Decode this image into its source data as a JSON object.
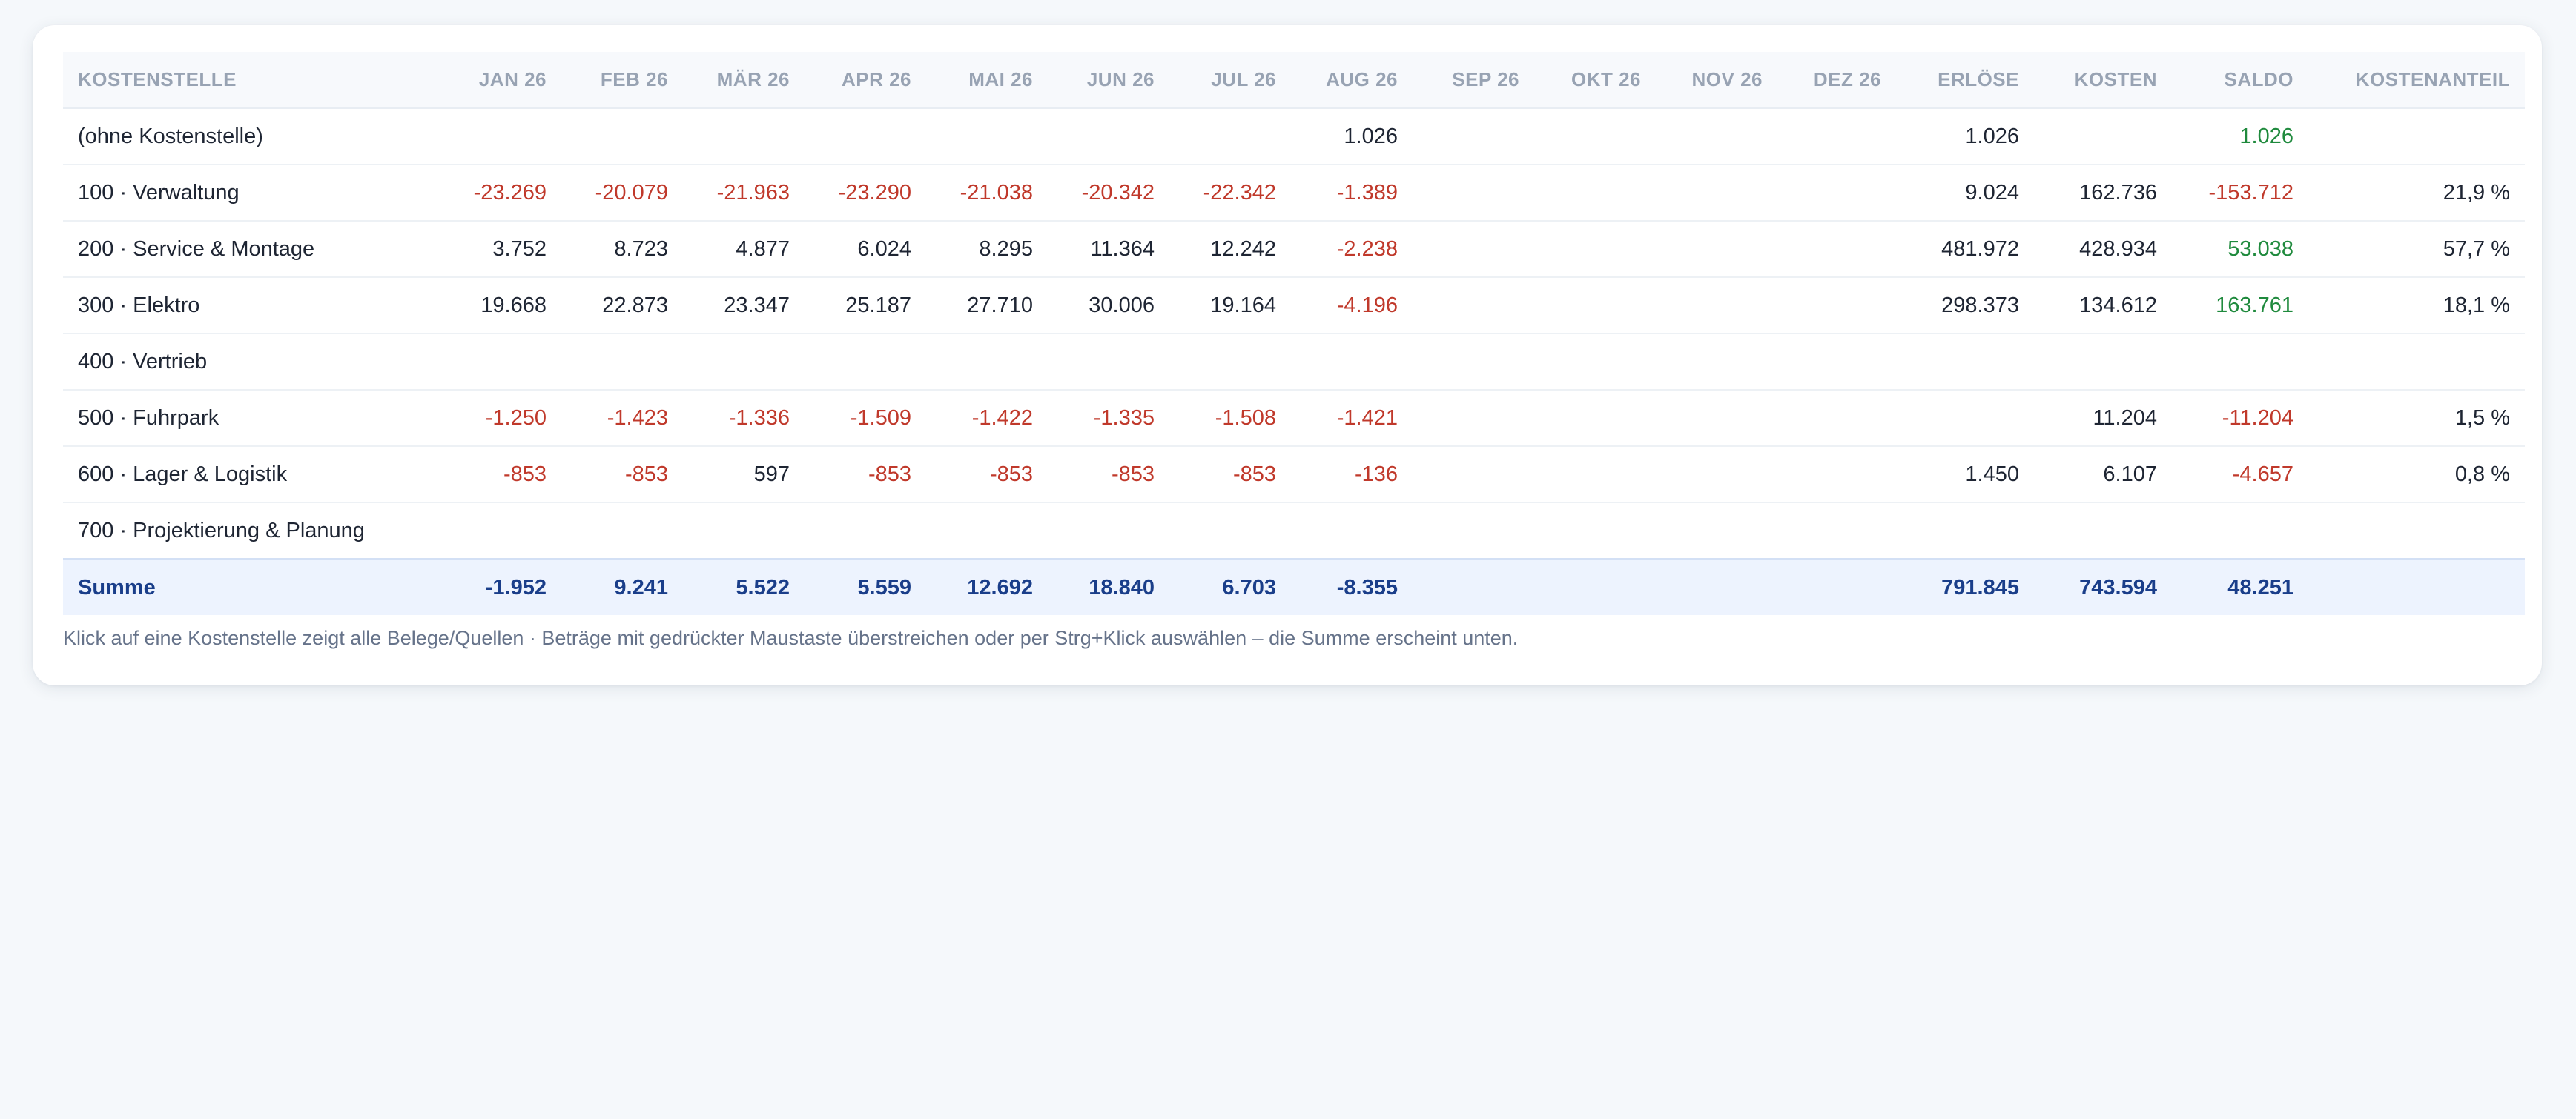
{
  "table": {
    "headers": [
      "KOSTENSTELLE",
      "JAN 26",
      "FEB 26",
      "MÄR 26",
      "APR 26",
      "MAI 26",
      "JUN 26",
      "JUL 26",
      "AUG 26",
      "SEP 26",
      "OKT 26",
      "NOV 26",
      "DEZ 26",
      "ERLÖSE",
      "KOSTEN",
      "SALDO",
      "KOSTENANTEIL"
    ],
    "rows": [
      {
        "label": "(ohne Kostenstelle)",
        "cells": [
          "",
          "",
          "",
          "",
          "",
          "",
          "",
          "1.026",
          "",
          "",
          "",
          "",
          "1.026",
          "",
          "1.026",
          ""
        ]
      },
      {
        "label": "100 · Verwaltung",
        "cells": [
          "-23.269",
          "-20.079",
          "-21.963",
          "-23.290",
          "-21.038",
          "-20.342",
          "-22.342",
          "-1.389",
          "",
          "",
          "",
          "",
          "9.024",
          "162.736",
          "-153.712",
          "21,9 %"
        ]
      },
      {
        "label": "200 · Service & Montage",
        "cells": [
          "3.752",
          "8.723",
          "4.877",
          "6.024",
          "8.295",
          "11.364",
          "12.242",
          "-2.238",
          "",
          "",
          "",
          "",
          "481.972",
          "428.934",
          "53.038",
          "57,7 %"
        ]
      },
      {
        "label": "300 · Elektro",
        "cells": [
          "19.668",
          "22.873",
          "23.347",
          "25.187",
          "27.710",
          "30.006",
          "19.164",
          "-4.196",
          "",
          "",
          "",
          "",
          "298.373",
          "134.612",
          "163.761",
          "18,1 %"
        ]
      },
      {
        "label": "400 · Vertrieb",
        "cells": [
          "",
          "",
          "",
          "",
          "",
          "",
          "",
          "",
          "",
          "",
          "",
          "",
          "",
          "",
          "",
          ""
        ]
      },
      {
        "label": "500 · Fuhrpark",
        "cells": [
          "-1.250",
          "-1.423",
          "-1.336",
          "-1.509",
          "-1.422",
          "-1.335",
          "-1.508",
          "-1.421",
          "",
          "",
          "",
          "",
          "",
          "11.204",
          "-11.204",
          "1,5 %"
        ]
      },
      {
        "label": "600 · Lager & Logistik",
        "cells": [
          "-853",
          "-853",
          "597",
          "-853",
          "-853",
          "-853",
          "-853",
          "-136",
          "",
          "",
          "",
          "",
          "1.450",
          "6.107",
          "-4.657",
          "0,8 %"
        ]
      },
      {
        "label": "700 · Projektierung & Planung",
        "cells": [
          "",
          "",
          "",
          "",
          "",
          "",
          "",
          "",
          "",
          "",
          "",
          "",
          "",
          "",
          "",
          ""
        ]
      }
    ],
    "sum": {
      "label": "Summe",
      "cells": [
        "-1.952",
        "9.241",
        "5.522",
        "5.559",
        "12.692",
        "18.840",
        "6.703",
        "-8.355",
        "",
        "",
        "",
        "",
        "791.845",
        "743.594",
        "48.251",
        ""
      ]
    }
  },
  "hint": "Klick auf eine Kostenstelle zeigt alle Belege/Quellen · Beträge mit gedrückter Maustaste überstreichen oder per Strg+Klick auswählen – die Summe erscheint unten.",
  "colors": {
    "negative": "#c0392b",
    "positive": "#1f8a3d",
    "sum": "#1a3e8a",
    "header": "#98a3b3"
  }
}
